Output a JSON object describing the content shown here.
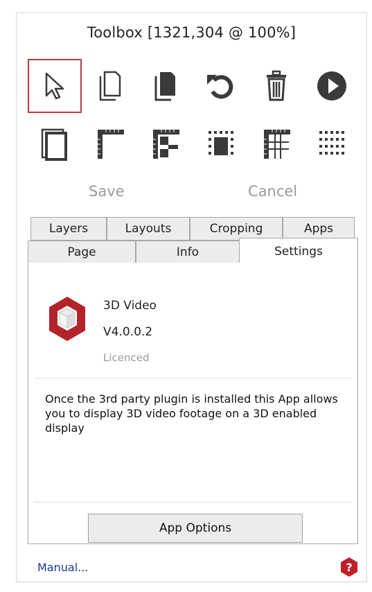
{
  "toolbox": {
    "title": "Toolbox [1321,304 @ 100%]",
    "tools_row1": [
      "pointer-icon",
      "new-page-icon",
      "copy-pages-icon",
      "undo-icon",
      "delete-icon",
      "play-icon"
    ],
    "tools_row2": [
      "page-frame-icon",
      "ruler-corner-icon",
      "ruler-split-icon",
      "fill-grid-icon",
      "ruler-grid-icon",
      "dot-grid-icon"
    ],
    "save_label": "Save",
    "cancel_label": "Cancel"
  },
  "tabs": {
    "row_back": [
      "Layers",
      "Layouts",
      "Cropping",
      "Apps"
    ],
    "row_front": [
      "Page",
      "Info",
      "Settings"
    ],
    "active": "Settings"
  },
  "app": {
    "name": "3D Video",
    "version": "V4.0.0.2",
    "status": "Licenced",
    "description": "Once the 3rd party plugin is installed this App allows you to display 3D video footage on a 3D enabled display",
    "options_button": "App Options"
  },
  "footer": {
    "manual_link": "Manual...",
    "help_icon": "help-icon"
  },
  "colors": {
    "accent": "#c0393b",
    "icon": "#3a3a3a",
    "muted_text": "#9a9a9a",
    "link": "#1a3a8e",
    "app_icon": "#b3242a"
  }
}
